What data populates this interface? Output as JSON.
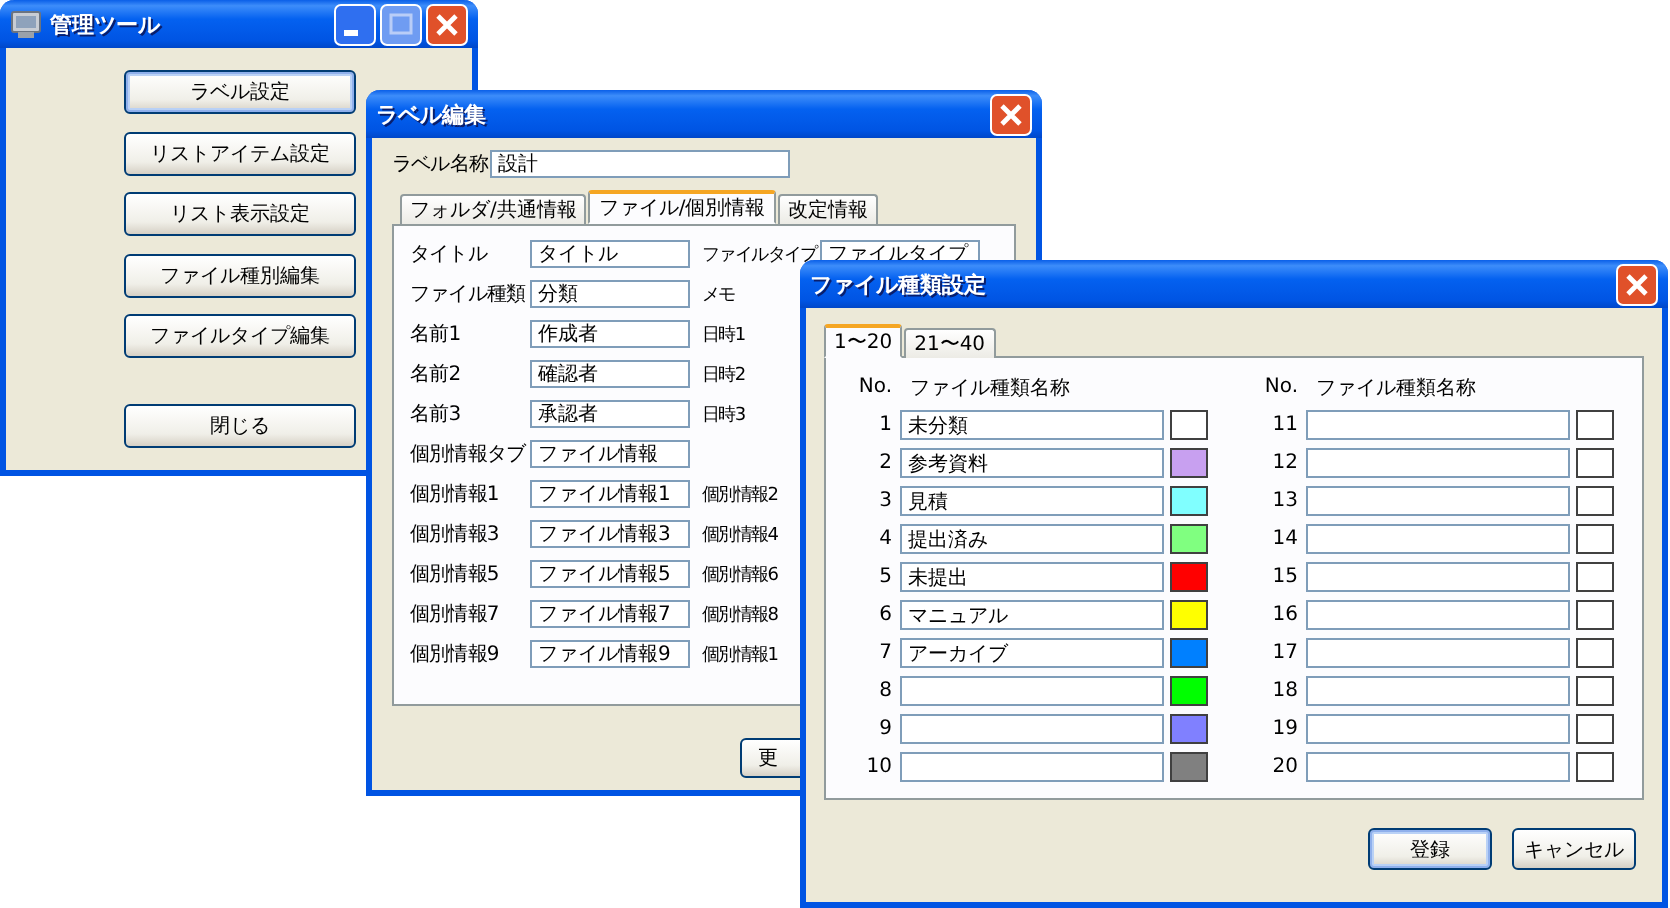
{
  "main_window": {
    "title": "管理ツール",
    "buttons": [
      {
        "label": "ラベル設定",
        "focused": true
      },
      {
        "label": "リストアイテム設定",
        "focused": false
      },
      {
        "label": "リスト表示設定",
        "focused": false
      },
      {
        "label": "ファイル種別編集",
        "focused": false
      },
      {
        "label": "ファイルタイプ編集",
        "focused": false
      },
      {
        "label": "閉じる",
        "focused": false
      }
    ]
  },
  "label_editor": {
    "title": "ラベル編集",
    "name_label": "ラベル名称",
    "name_value": "設計",
    "tabs": [
      {
        "label": "フォルダ/共通情報",
        "selected": false
      },
      {
        "label": "ファイル/個別情報",
        "selected": true
      },
      {
        "label": "改定情報",
        "selected": false
      }
    ],
    "rows": [
      {
        "label": "タイトル",
        "value": "タイトル",
        "side_label": "ファイルタイプ",
        "side_value": "ファイルタイプ"
      },
      {
        "label": "ファイル種類",
        "value": "分類",
        "side_label": "メモ"
      },
      {
        "label": "名前1",
        "value": "作成者",
        "side_label": "日時1"
      },
      {
        "label": "名前2",
        "value": "確認者",
        "side_label": "日時2"
      },
      {
        "label": "名前3",
        "value": "承認者",
        "side_label": "日時3"
      },
      {
        "label": "個別情報タブ",
        "value": "ファイル情報"
      },
      {
        "label": "個別情報1",
        "value": "ファイル情報1",
        "side_label": "個別情報2"
      },
      {
        "label": "個別情報3",
        "value": "ファイル情報3",
        "side_label": "個別情報4"
      },
      {
        "label": "個別情報5",
        "value": "ファイル情報5",
        "side_label": "個別情報6"
      },
      {
        "label": "個別情報7",
        "value": "ファイル情報7",
        "side_label": "個別情報8"
      },
      {
        "label": "個別情報9",
        "value": "ファイル情報9",
        "side_label": "個別情報1"
      }
    ],
    "update_button": "更"
  },
  "file_type_dialog": {
    "title": "ファイル種類設定",
    "tabs": [
      {
        "label": "1〜20",
        "selected": true
      },
      {
        "label": "21〜40",
        "selected": false
      }
    ],
    "columns": [
      {
        "no_header": "No.",
        "name_header": "ファイル種類名称",
        "rows": [
          {
            "no": "1",
            "value": "未分類",
            "color": "#ffffff"
          },
          {
            "no": "2",
            "value": "参考資料",
            "color": "#c8a0f0"
          },
          {
            "no": "3",
            "value": "見積",
            "color": "#80ffff"
          },
          {
            "no": "4",
            "value": "提出済み",
            "color": "#80ff80"
          },
          {
            "no": "5",
            "value": "未提出",
            "color": "#ff0000"
          },
          {
            "no": "6",
            "value": "マニュアル",
            "color": "#ffff00"
          },
          {
            "no": "7",
            "value": "アーカイブ",
            "color": "#0080ff"
          },
          {
            "no": "8",
            "value": "",
            "color": "#00ff00"
          },
          {
            "no": "9",
            "value": "",
            "color": "#8080ff"
          },
          {
            "no": "10",
            "value": "",
            "color": "#808080"
          }
        ]
      },
      {
        "no_header": "No.",
        "name_header": "ファイル種類名称",
        "rows": [
          {
            "no": "11",
            "value": "",
            "color": "#ffffff"
          },
          {
            "no": "12",
            "value": "",
            "color": "#ffffff"
          },
          {
            "no": "13",
            "value": "",
            "color": "#ffffff"
          },
          {
            "no": "14",
            "value": "",
            "color": "#ffffff"
          },
          {
            "no": "15",
            "value": "",
            "color": "#ffffff"
          },
          {
            "no": "16",
            "value": "",
            "color": "#ffffff"
          },
          {
            "no": "17",
            "value": "",
            "color": "#ffffff"
          },
          {
            "no": "18",
            "value": "",
            "color": "#ffffff"
          },
          {
            "no": "19",
            "value": "",
            "color": "#ffffff"
          },
          {
            "no": "20",
            "value": "",
            "color": "#ffffff"
          }
        ]
      }
    ],
    "buttons": [
      {
        "label": "登録",
        "default": true
      },
      {
        "label": "キャンセル",
        "default": false
      }
    ]
  }
}
